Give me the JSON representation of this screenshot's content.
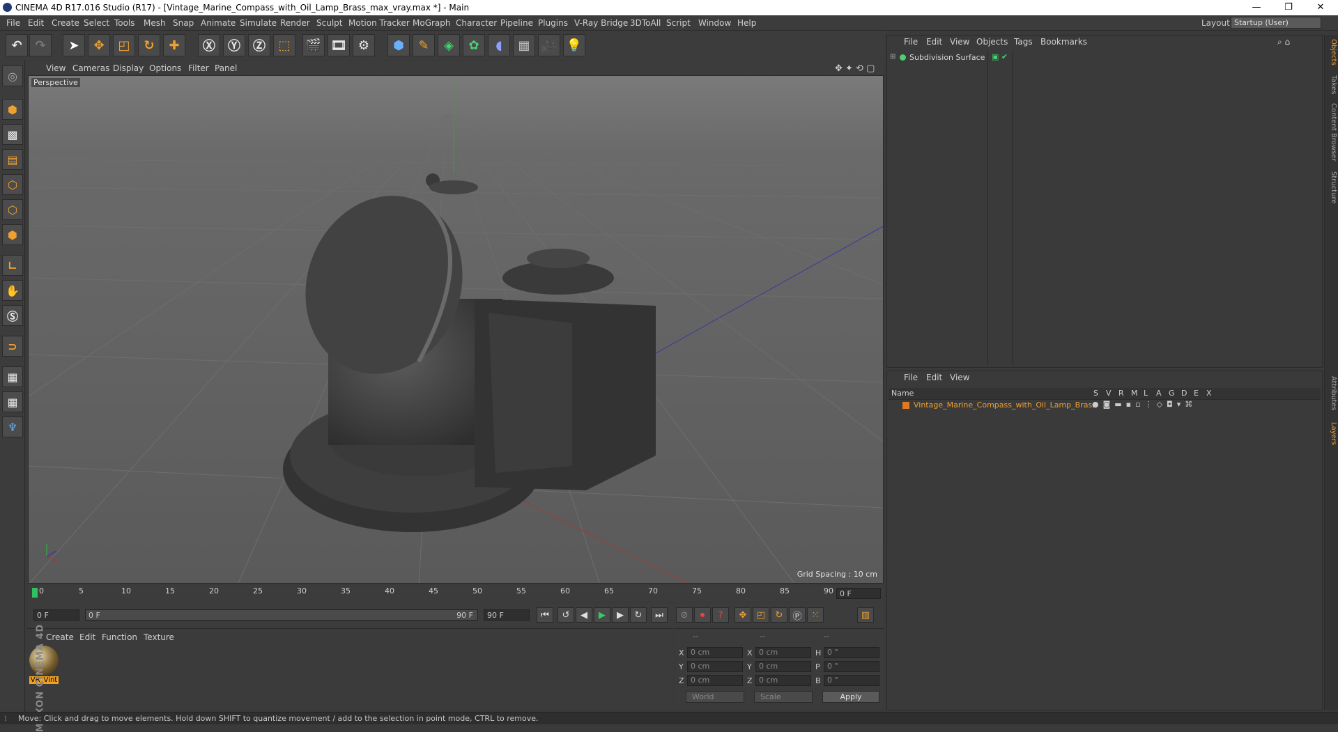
{
  "window": {
    "title": "CINEMA 4D R17.016 Studio (R17) - [Vintage_Marine_Compass_with_Oil_Lamp_Brass_max_vray.max *] - Main",
    "minimize": "—",
    "restore": "❐",
    "close": "✕"
  },
  "menubar": {
    "items": [
      "File",
      "Edit",
      "Create",
      "Select",
      "Tools",
      "Mesh",
      "Snap",
      "Animate",
      "Simulate",
      "Render",
      "Sculpt",
      "Motion Tracker",
      "MoGraph",
      "Character",
      "Pipeline",
      "Plugins",
      "V-Ray Bridge",
      "3DToAll",
      "Script",
      "Window",
      "Help"
    ],
    "layout_label": "Layout:",
    "layout_value": "Startup (User)"
  },
  "viewport": {
    "menu": [
      "View",
      "Cameras",
      "Display",
      "Options",
      "Filter",
      "Panel"
    ],
    "label": "Perspective",
    "grid_spacing": "Grid Spacing : 10 cm"
  },
  "timeline": {
    "ticks": [
      "0",
      "5",
      "10",
      "15",
      "20",
      "25",
      "30",
      "35",
      "40",
      "45",
      "50",
      "55",
      "60",
      "65",
      "70",
      "75",
      "80",
      "85",
      "90"
    ],
    "current_frame": "0 F",
    "start_frame": "0 F",
    "range_start": "0 F",
    "range_end": "90 F",
    "end_frame": "90 F"
  },
  "materials": {
    "menu": [
      "Create",
      "Edit",
      "Function",
      "Texture"
    ],
    "item_name": "VR_Vint"
  },
  "coordinates": {
    "headers": [
      "--",
      "--",
      "--"
    ],
    "rows": [
      {
        "a": "X",
        "av": "0 cm",
        "b": "X",
        "bv": "0 cm",
        "c": "H",
        "cv": "0 °"
      },
      {
        "a": "Y",
        "av": "0 cm",
        "b": "Y",
        "bv": "0 cm",
        "c": "P",
        "cv": "0 °"
      },
      {
        "a": "Z",
        "av": "0 cm",
        "b": "Z",
        "bv": "0 cm",
        "c": "B",
        "cv": "0 °"
      }
    ],
    "mode1": "World",
    "mode2": "Scale",
    "apply": "Apply"
  },
  "objects": {
    "menu": [
      "File",
      "Edit",
      "View",
      "Objects",
      "Tags",
      "Bookmarks"
    ],
    "item": "Subdivision Surface"
  },
  "layers": {
    "menu": [
      "File",
      "Edit",
      "View"
    ],
    "columns": [
      "Name",
      "S",
      "V",
      "R",
      "M",
      "L",
      "A",
      "G",
      "D",
      "E",
      "X"
    ],
    "row_name": "Vintage_Marine_Compass_with_Oil_Lamp_Brass",
    "row_color": "#e07a20"
  },
  "right_tabs": [
    "Objects",
    "Takes",
    "Content Browser",
    "Structure",
    "Attributes",
    "Layers"
  ],
  "brand": "MAXON CINEMA 4D",
  "status": "Move: Click and drag to move elements. Hold down SHIFT to quantize movement / add to the selection in point mode, CTRL to remove."
}
